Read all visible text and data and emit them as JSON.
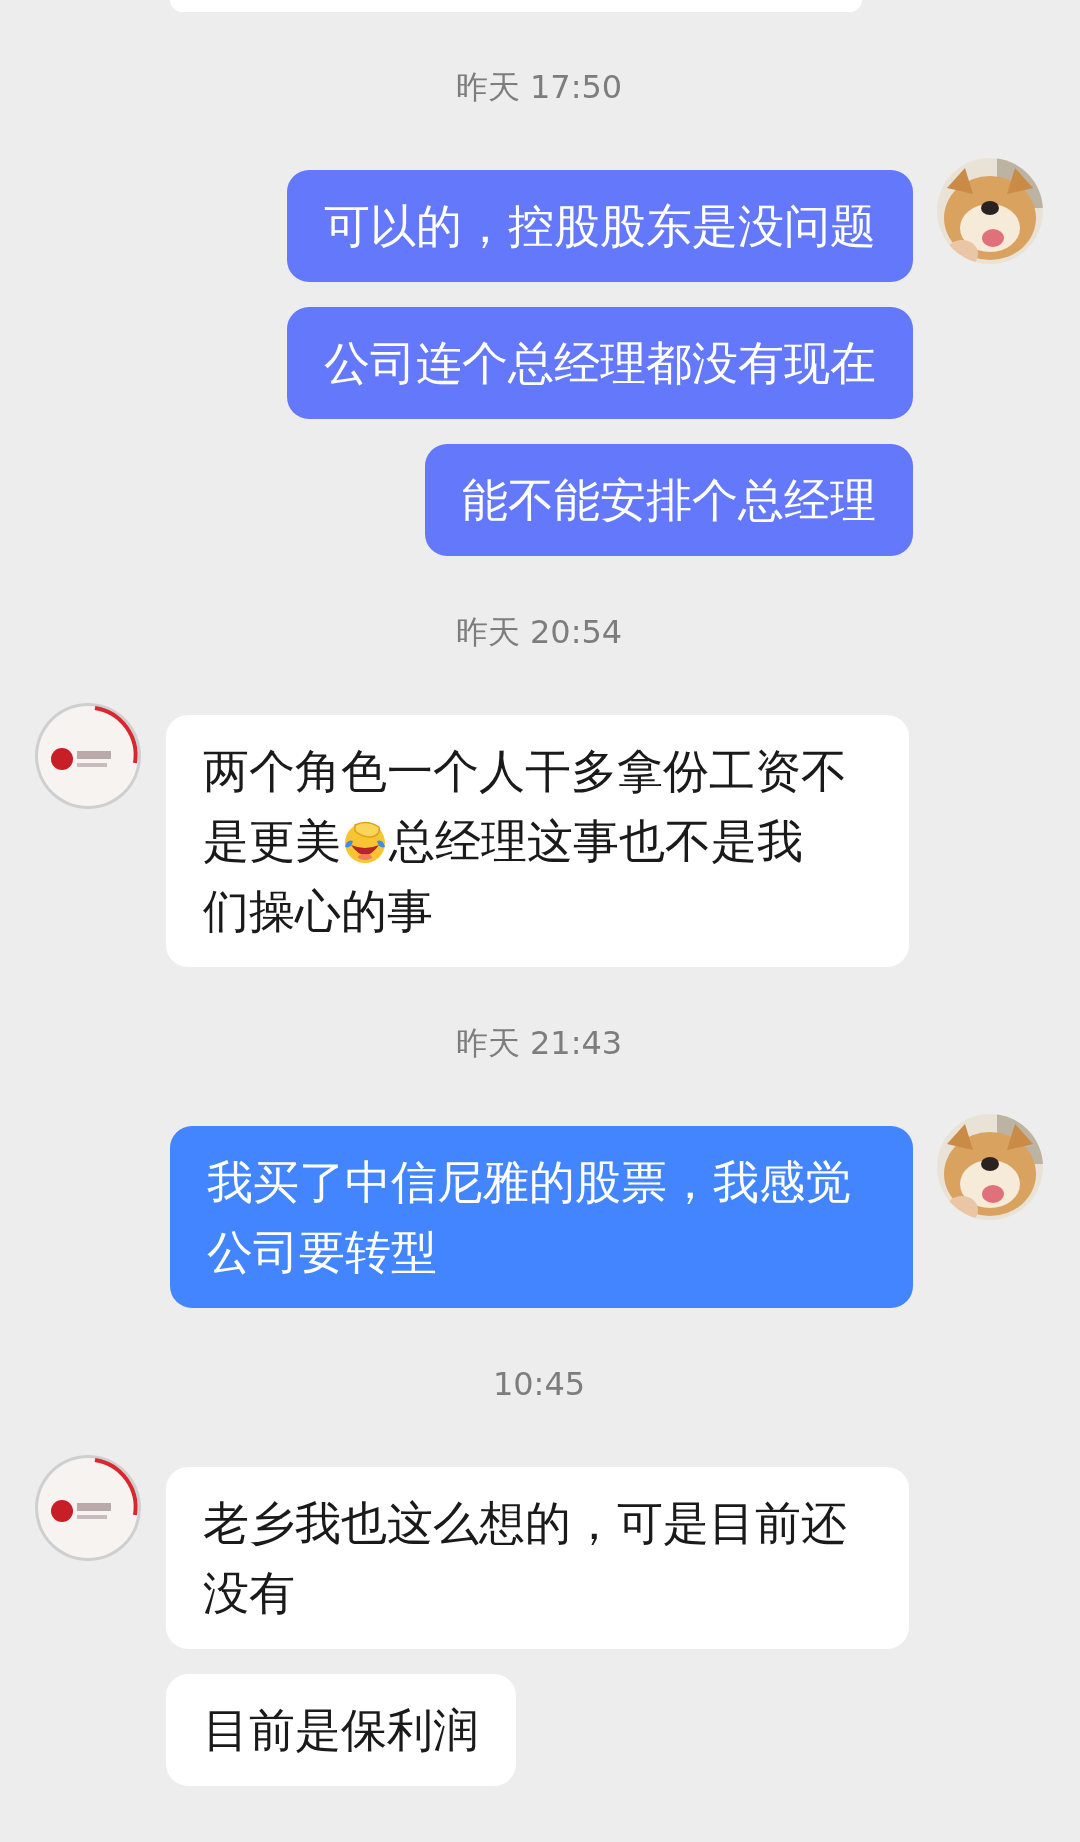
{
  "items": [
    {
      "kind": "clipped"
    },
    {
      "kind": "time",
      "text": "昨天 17:50"
    },
    {
      "kind": "message",
      "outgoing": true,
      "avatar": true,
      "color": "#6478fc",
      "text": "可以的，控股股东是没问题"
    },
    {
      "kind": "message",
      "outgoing": true,
      "avatar": false,
      "color": "#6478fc",
      "text": "公司连个总经理都没有现在"
    },
    {
      "kind": "message",
      "outgoing": true,
      "avatar": false,
      "color": "#6478fc",
      "text": "能不能安排个总经理"
    },
    {
      "kind": "time",
      "text": "昨天 20:54"
    },
    {
      "kind": "message",
      "outgoing": false,
      "avatar": true,
      "lines": [
        [
          {
            "kind": "text",
            "text": "两个角色一个人干多拿份工资不"
          }
        ],
        [
          {
            "kind": "text",
            "text": "是更美"
          },
          {
            "kind": "emoji"
          },
          {
            "kind": "text",
            "text": "总经理这事也不是我"
          }
        ],
        [
          {
            "kind": "text",
            "text": "们操心的事"
          }
        ]
      ]
    },
    {
      "kind": "time",
      "text": "昨天 21:43"
    },
    {
      "kind": "message",
      "outgoing": true,
      "avatar": true,
      "color": "#4285ff",
      "text": "我买了中信尼雅的股票，我感觉公司要转型"
    },
    {
      "kind": "time",
      "text": "10:45"
    },
    {
      "kind": "message",
      "outgoing": false,
      "avatar": true,
      "text": "老乡我也这么想的，可是目前还没有"
    },
    {
      "kind": "message",
      "outgoing": false,
      "avatar": false,
      "text": "目前是保利润"
    }
  ]
}
